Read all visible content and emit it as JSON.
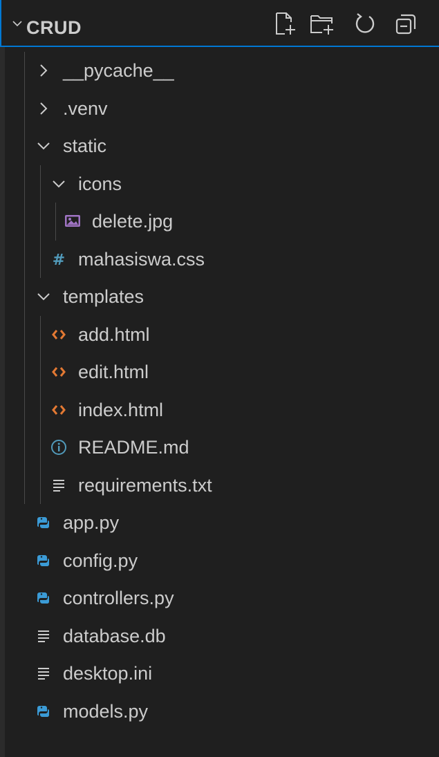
{
  "explorer": {
    "title": "CRUD",
    "actions": [
      {
        "name": "new-file-icon"
      },
      {
        "name": "new-folder-icon"
      },
      {
        "name": "refresh-icon"
      },
      {
        "name": "collapse-all-icon"
      }
    ]
  },
  "tree": [
    {
      "label": "__pycache__",
      "type": "folder",
      "state": "collapsed",
      "depth": 1
    },
    {
      "label": ".venv",
      "type": "folder",
      "state": "collapsed",
      "depth": 1
    },
    {
      "label": "static",
      "type": "folder",
      "state": "expanded",
      "depth": 1
    },
    {
      "label": "icons",
      "type": "folder",
      "state": "expanded",
      "depth": 2
    },
    {
      "label": "delete.jpg",
      "type": "image",
      "icon": "image-file-icon",
      "depth": 3
    },
    {
      "label": "mahasiswa.css",
      "type": "css",
      "icon": "css-file-icon",
      "depth": 2
    },
    {
      "label": "templates",
      "type": "folder",
      "state": "expanded",
      "depth": 1
    },
    {
      "label": "add.html",
      "type": "html",
      "icon": "html-file-icon",
      "depth": 2
    },
    {
      "label": "edit.html",
      "type": "html",
      "icon": "html-file-icon",
      "depth": 2
    },
    {
      "label": "index.html",
      "type": "html",
      "icon": "html-file-icon",
      "depth": 2
    },
    {
      "label": "README.md",
      "type": "info",
      "icon": "info-file-icon",
      "depth": 2
    },
    {
      "label": "requirements.txt",
      "type": "text",
      "icon": "text-file-icon",
      "depth": 2
    },
    {
      "label": "app.py",
      "type": "python",
      "icon": "python-file-icon",
      "depth": 1
    },
    {
      "label": "config.py",
      "type": "python",
      "icon": "python-file-icon",
      "depth": 1
    },
    {
      "label": "controllers.py",
      "type": "python",
      "icon": "python-file-icon",
      "depth": 1
    },
    {
      "label": "database.db",
      "type": "text",
      "icon": "text-file-icon",
      "depth": 1
    },
    {
      "label": "desktop.ini",
      "type": "text",
      "icon": "text-file-icon",
      "depth": 1
    },
    {
      "label": "models.py",
      "type": "python",
      "icon": "python-file-icon",
      "depth": 1
    }
  ],
  "colors": {
    "background": "#1f1f1f",
    "text": "#cccccc",
    "focus": "#0078d4",
    "html": "#e37933",
    "css": "#519aba",
    "python": "#3b9bd6",
    "image": "#a074c4",
    "info": "#519aba"
  }
}
